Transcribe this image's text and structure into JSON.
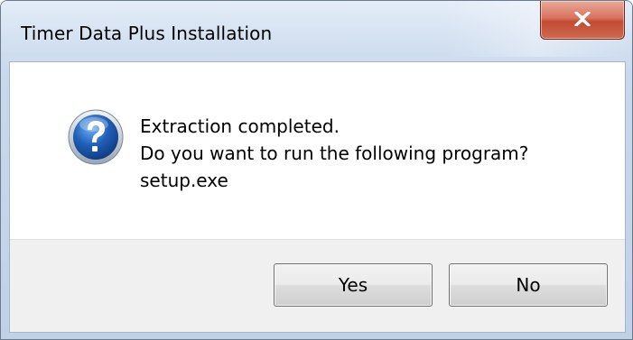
{
  "window": {
    "title": "Timer Data Plus Installation",
    "close_icon": "close-icon"
  },
  "message": {
    "icon": "question-icon",
    "lines": [
      "Extraction completed.",
      "Do you want to run the following program?",
      "setup.exe"
    ]
  },
  "buttons": {
    "yes_label": "Yes",
    "no_label": "No"
  },
  "colors": {
    "titlebar": "#cddcee",
    "close_button": "#c24a33",
    "question_icon": "#1f5fb8",
    "button_area": "#f0f0f0"
  }
}
